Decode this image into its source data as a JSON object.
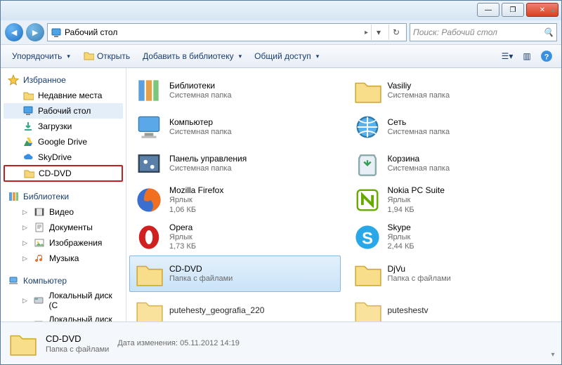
{
  "window": {
    "min_tip": "—",
    "max_tip": "❐",
    "close_tip": "✕"
  },
  "address": {
    "location": "Рабочий стол",
    "sep": "▸"
  },
  "search": {
    "placeholder": "Поиск: Рабочий стол"
  },
  "toolbar": {
    "organize": "Упорядочить",
    "open": "Открыть",
    "add_library": "Добавить в библиотеку",
    "share": "Общий доступ"
  },
  "sidebar": {
    "favorites": {
      "label": "Избранное"
    },
    "fav": [
      {
        "label": "Недавние места"
      },
      {
        "label": "Рабочий стол"
      },
      {
        "label": "Загрузки"
      },
      {
        "label": "Google Drive"
      },
      {
        "label": "SkyDrive"
      },
      {
        "label": "CD-DVD"
      }
    ],
    "libraries": {
      "label": "Библиотеки"
    },
    "lib": [
      {
        "label": "Видео"
      },
      {
        "label": "Документы"
      },
      {
        "label": "Изображения"
      },
      {
        "label": "Музыка"
      }
    ],
    "computer": {
      "label": "Компьютер"
    },
    "comp": [
      {
        "label": "Локальный диск (C"
      },
      {
        "label": "Локальный диск (D"
      }
    ]
  },
  "items": [
    {
      "name": "Библиотеки",
      "desc": "Системная папка"
    },
    {
      "name": "Vasiliy",
      "desc": "Системная папка"
    },
    {
      "name": "Компьютер",
      "desc": "Системная папка"
    },
    {
      "name": "Сеть",
      "desc": "Системная папка"
    },
    {
      "name": "Панель управления",
      "desc": "Системная папка"
    },
    {
      "name": "Корзина",
      "desc": "Системная папка"
    },
    {
      "name": "Mozilla Firefox",
      "desc": "Ярлык",
      "size": "1,06 КБ"
    },
    {
      "name": "Nokia PC Suite",
      "desc": "Ярлык",
      "size": "1,94 КБ"
    },
    {
      "name": "Opera",
      "desc": "Ярлык",
      "size": "1,73 КБ"
    },
    {
      "name": "Skype",
      "desc": "Ярлык",
      "size": "2,44 КБ"
    },
    {
      "name": "CD-DVD",
      "desc": "Папка с файлами"
    },
    {
      "name": "DjVu",
      "desc": "Папка с файлами"
    },
    {
      "name": "putehesty_geografia_220",
      "desc": ""
    },
    {
      "name": "puteshestv",
      "desc": ""
    }
  ],
  "details": {
    "name": "CD-DVD",
    "type": "Папка с файлами",
    "modified_label": "Дата изменения:",
    "modified_value": "05.11.2012 14:19"
  },
  "icons": {
    "star": "star-icon",
    "folder": "folder-icon",
    "monitor": "monitor-icon",
    "download": "download-icon",
    "gdrive": "gdrive-icon",
    "skydrive": "skydrive-icon",
    "library": "library-icon",
    "video": "video-icon",
    "document": "document-icon",
    "image": "image-icon",
    "music": "music-icon",
    "computer": "computer-icon",
    "disk": "disk-icon",
    "network": "network-icon",
    "cpanel": "cpanel-icon",
    "recycle": "recycle-icon",
    "firefox": "firefox-icon",
    "nokia": "nokia-icon",
    "opera": "opera-icon",
    "skype": "skype-icon"
  }
}
